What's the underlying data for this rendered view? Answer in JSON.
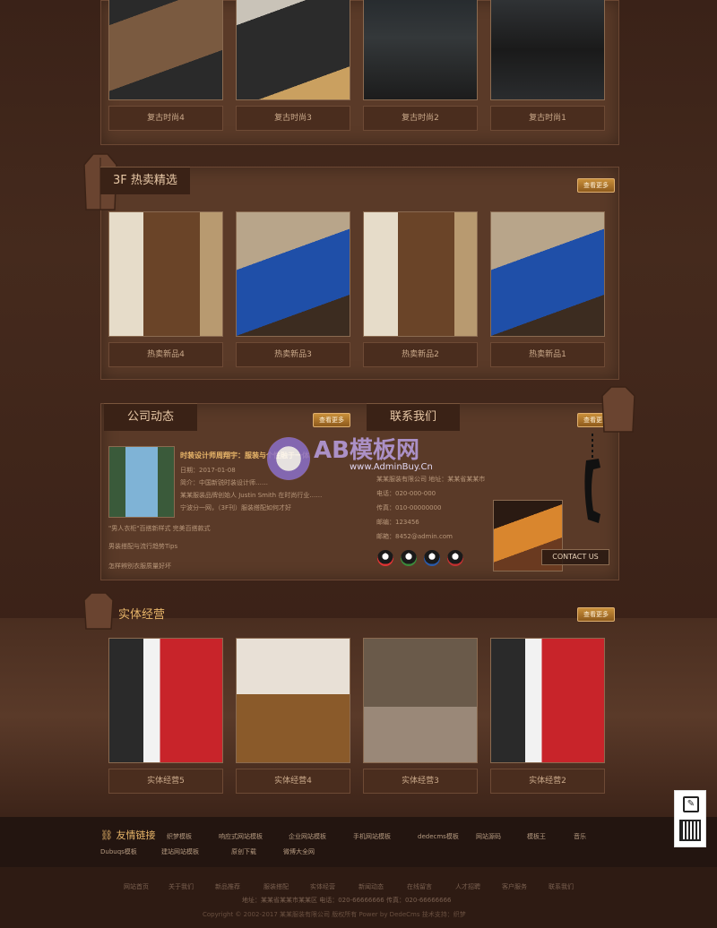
{
  "top_gallery": {
    "items": [
      "复古时尚4",
      "复古时尚3",
      "复古时尚2",
      "复古时尚1"
    ]
  },
  "hot": {
    "title": "3F 热卖精选",
    "more": "查看更多",
    "items": [
      "热卖新品4",
      "热卖新品3",
      "热卖新品2",
      "热卖新品1"
    ]
  },
  "news": {
    "title": "公司动态",
    "more": "查看更多",
    "headline": "时装设计师周翔宇：服装与个性融于一体",
    "lines": [
      "日期：2017-01-08",
      "简介：中国新锐时装设计师……",
      "某某服装品牌创始人 Justin Smith 在时尚行业……",
      "宁波分一网，（3F刊）服装搭配如何才好"
    ],
    "list": [
      "\"男人衣柜\"百搭新样式 完美百搭款式",
      "男装搭配与流行趋势Tips",
      "怎样辨别衣服质量好坏"
    ]
  },
  "contact": {
    "title": "联系我们",
    "more": "查看更多",
    "lines": [
      "某某服装有限公司 地址：某某省某某市",
      "电话：020-000-000",
      "传真：010-00000000",
      "邮编：123456",
      "邮箱：8452@admin.com"
    ],
    "badge": "CONTACT US"
  },
  "store": {
    "title": "实体经营",
    "more": "查看更多",
    "items": [
      "实体经营5",
      "实体经营4",
      "实体经营3",
      "实体经营2"
    ]
  },
  "watermark": {
    "title": "AB模板网",
    "url": "www.AdminBuy.Cn"
  },
  "links": {
    "title": "友情链接",
    "row1": [
      "织梦模板",
      "响应式网站模板",
      "企业网站模板",
      "手机网站模板",
      "dedecms模板",
      "网站源码",
      "模板王",
      "音乐"
    ],
    "row2": [
      "Dubuqs模板",
      "建站网站模板",
      "原创下载",
      "微博大全网"
    ]
  },
  "footer": {
    "nav": [
      "网站首页",
      "关于我们",
      "新品推荐",
      "服装搭配",
      "实体经营",
      "新闻动态",
      "在线留言",
      "人才招聘",
      "客户服务",
      "联系我们"
    ],
    "addr": "地址：某某省某某市某某区 电话：020-66666666 传真：020-66666666",
    "copy": "Copyright © 2002-2017 某某服装有限公司 版权所有 Power by DedeCms 技术支持：织梦"
  }
}
